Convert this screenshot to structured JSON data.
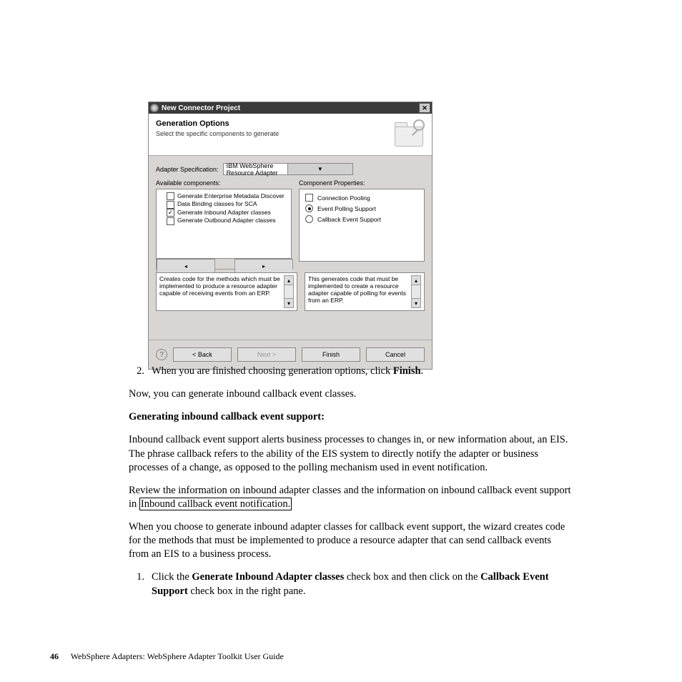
{
  "dialog": {
    "title": "New Connector Project",
    "header_title": "Generation Options",
    "header_sub": "Select the specific components to generate",
    "spec_label": "Adapter Specification:",
    "spec_value": "IBM WebSphere Resource Adapter",
    "avail_label": "Available components:",
    "props_label": "Component Properties:",
    "tree": {
      "t0": "Generate Enterprise Metadata Discover",
      "t1": "Data Binding classes for SCA",
      "t2": "Generate Inbound Adapter classes",
      "t3": "Generate Outbound Adapter classes"
    },
    "props": {
      "p0": "Connection Pooling",
      "p1": "Event Polling Support",
      "p2": "Callback Event Support"
    },
    "desc_left": "Creates code for the methods which must be implemented to produce a resource adapter capable of receiving events from an ERP.",
    "desc_right": "This generates code that must be implemented to create a resource adapter capable of polling for events from an ERP.",
    "btn_back": "< Back",
    "btn_next": "Next >",
    "btn_finish": "Finish",
    "btn_cancel": "Cancel"
  },
  "doc": {
    "step2_num": "2.",
    "step2_a": "When you are finished choosing generation options, click ",
    "step2_b": "Finish",
    "step2_c": ".",
    "line_now": "Now, you can generate inbound callback event classes.",
    "h4": "Generating inbound callback event support:",
    "para_support": "Inbound callback event support alerts business processes to changes in, or new information about, an EIS. The phrase callback refers to the ability of the EIS system to directly notify the adapter or business processes of a change, as opposed to the polling mechanism used in event notification.",
    "review_a": "Review the information on inbound adapter classes and the information on inbound callback event support in ",
    "review_link": "Inbound callback event notification.",
    "when": "When you choose to generate inbound adapter classes for callback event support, the wizard creates code for the methods that must be implemented to produce a resource adapter that can send callback events from an EIS to a business process.",
    "step1_num": "1.",
    "step1_a": "Click the ",
    "step1_b": "Generate Inbound Adapter classes",
    "step1_c": " check box and then click on the ",
    "step1_d": "Callback Event Support",
    "step1_e": " check box in the right pane."
  },
  "footer": {
    "page": "46",
    "title": "WebSphere Adapters: WebSphere Adapter Toolkit User Guide"
  }
}
